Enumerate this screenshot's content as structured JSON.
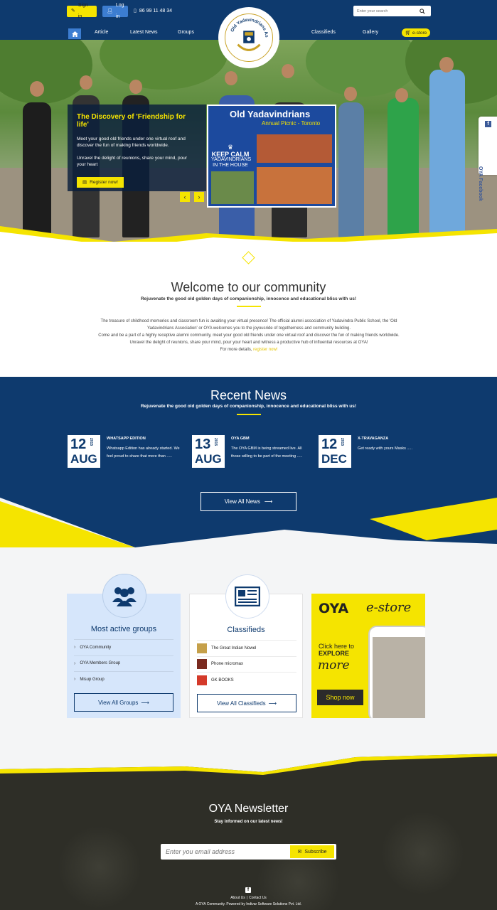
{
  "header": {
    "signin_label": "Sign in",
    "login_label": "Log in",
    "phone": "86 99 11 48 34",
    "search_placeholder": "Enter your search",
    "nav": [
      "Article",
      "Latest News",
      "Groups",
      "Classifieds",
      "Gallery"
    ],
    "estore_label": "e-store",
    "logo_text": "Old Yadavindrians Association"
  },
  "hero": {
    "title": "The Discovery of 'Friendship for life'",
    "p1": "Meet your good old friends under one virtual roof and discover the fun of making friends worldwide.",
    "p2": "Unravel the delight of reunions, share your mind, pour your heart",
    "register_label": "Register now!",
    "banner_title": "Old Yadavindrians",
    "banner_sub": "Annual Picnic - Toronto",
    "keep_calm_top": "KEEP CALM",
    "keep_calm_bottom": "YADAVINDRIANS IN THE HOUSE",
    "side_label": "OYA Facebook"
  },
  "welcome": {
    "title": "Welcome to our community",
    "subtitle": "Rejuvenate the good old golden days of companionship, innocence and educational bliss with us!",
    "body1": "The treasure of childhood memories and classroom fun is awaiting your virtual presence! The official alumni association of Yadavindra Public School, the 'Old Yadavindrians Association' or OYA welcomes you to the joyousride of togetherness and community building.",
    "body2": "Come and be a part of a highly receptive alumni community, meet your good old friends under one virtual roof and discover the fun of making friends worldwide. Unravel the delight of reunions, share your mind, pour your heart and witness a productive hub of influential resources at OYA!",
    "body3": "For more details,",
    "body3_link": "register now!"
  },
  "news": {
    "title": "Recent News",
    "subtitle": "Rejuvenate the good old golden days of companionship, innocence and educational bliss with us!",
    "items": [
      {
        "day": "12",
        "month": "AUG",
        "year": "2015",
        "title": "WHATSAPP EDITION",
        "text": "Whatsapp Edition has already started. We feel proud to share that more than ....."
      },
      {
        "day": "13",
        "month": "AUG",
        "year": "2015",
        "title": "OYA GBM",
        "text": "The OYA GBM is being streamed live. All those willing to be part of the meeting ....."
      },
      {
        "day": "12",
        "month": "DEC",
        "year": "2015",
        "title": "X-TRAVAGANZA",
        "text": "Get ready with yours Masks ....."
      }
    ],
    "view_all_label": "View All News"
  },
  "groups": {
    "title": "Most active groups",
    "items": [
      "OYA Community",
      "OYA Members Group",
      "Misup Group"
    ],
    "button_label": "View All Groups"
  },
  "classifieds": {
    "title": "Classifieds",
    "items": [
      "The Great Indian Nowel",
      "Phone micromax",
      "GK BOOKS"
    ],
    "button_label": "View All Classifieds"
  },
  "estore": {
    "oya": "OYA",
    "store": "e-store",
    "click": "Click here to",
    "explore": "EXPLORE",
    "more": "more",
    "shop_label": "Shop now"
  },
  "newsletter": {
    "title": "OYA Newsletter",
    "subtitle": "Stay informed on our latest news!",
    "email_placeholder": "Enter you email address",
    "subscribe_label": "Subscribe"
  },
  "footer": {
    "links": [
      "About Us",
      "Contact Us"
    ],
    "copyright": "A OYA Community. Powered by Indivar Software Solutions Pvt. Ltd."
  },
  "colors": {
    "navy": "#0e3a6e",
    "yellow": "#f5e400",
    "blue": "#3c7dd1",
    "dark": "#2e2e27"
  }
}
